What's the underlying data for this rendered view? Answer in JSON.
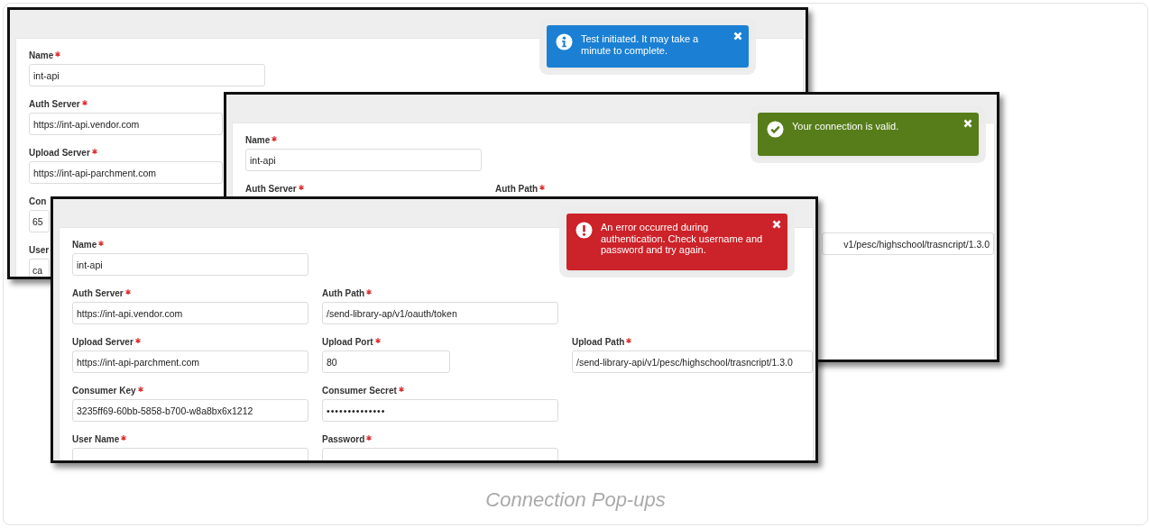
{
  "figure": {
    "panels": [
      {
        "rows": [
          [
            {
              "label": "Name",
              "required": true,
              "value": "int-api",
              "kind": "text"
            }
          ],
          [
            {
              "label": "Auth Server",
              "required": true,
              "value": "https://int-api.vendor.com",
              "kind": "text"
            }
          ],
          [
            {
              "label": "Upload Server",
              "required": true,
              "value": "https://int-api-parchment.com",
              "kind": "text"
            }
          ],
          [
            {
              "label": "Con",
              "value": "65",
              "kind": "text"
            }
          ],
          [
            {
              "label": "User",
              "value": "ca",
              "kind": "text"
            }
          ]
        ],
        "toast": {
          "kind": "info",
          "message": "Test initiated. It may take a minute to complete."
        }
      },
      {
        "rows": [
          [
            {
              "label": "Name",
              "required": true,
              "value": "int-api",
              "kind": "text"
            }
          ],
          [
            {
              "label": "Auth Server",
              "required": true,
              "kind": "text"
            },
            {
              "label": "Auth Path",
              "required": true,
              "kind": "text"
            }
          ],
          [
            {
              "value": "v1/pesc/highschool/trasncript/1.3.0",
              "kind": "clipped"
            }
          ]
        ],
        "toast": {
          "kind": "success",
          "message": "Your connection is valid."
        }
      },
      {
        "rows": [
          [
            {
              "label": "Name",
              "required": true,
              "value": "int-api",
              "kind": "text"
            }
          ],
          [
            {
              "label": "Auth Server",
              "required": true,
              "value": "https://int-api.vendor.com",
              "kind": "text"
            },
            {
              "label": "Auth Path",
              "required": true,
              "value": "/send-library-ap/v1/oauth/token",
              "kind": "text"
            }
          ],
          [
            {
              "label": "Upload Server",
              "required": true,
              "value": "https://int-api-parchment.com",
              "kind": "text"
            },
            {
              "label": "Upload Port",
              "required": true,
              "value": "80",
              "kind": "number"
            },
            {
              "label": "Upload Path",
              "required": true,
              "value": "/send-library-api/v1/pesc/highschool/trasncript/1.3.0",
              "kind": "text"
            }
          ],
          [
            {
              "label": "Consumer Key",
              "required": true,
              "value": "3235ff69-60bb-5858-b700-w8a8bx6x1212",
              "kind": "text"
            },
            {
              "label": "Consumer Secret",
              "required": true,
              "value": "••••••••••••••",
              "kind": "password"
            }
          ],
          [
            {
              "label": "User Name",
              "required": true,
              "kind": "text"
            },
            {
              "label": "Password",
              "required": true,
              "kind": "text"
            }
          ]
        ],
        "toast": {
          "kind": "error",
          "message": "An error occurred during authentication. Check username and password and try again."
        }
      }
    ],
    "caption": "Connection Pop-ups"
  }
}
